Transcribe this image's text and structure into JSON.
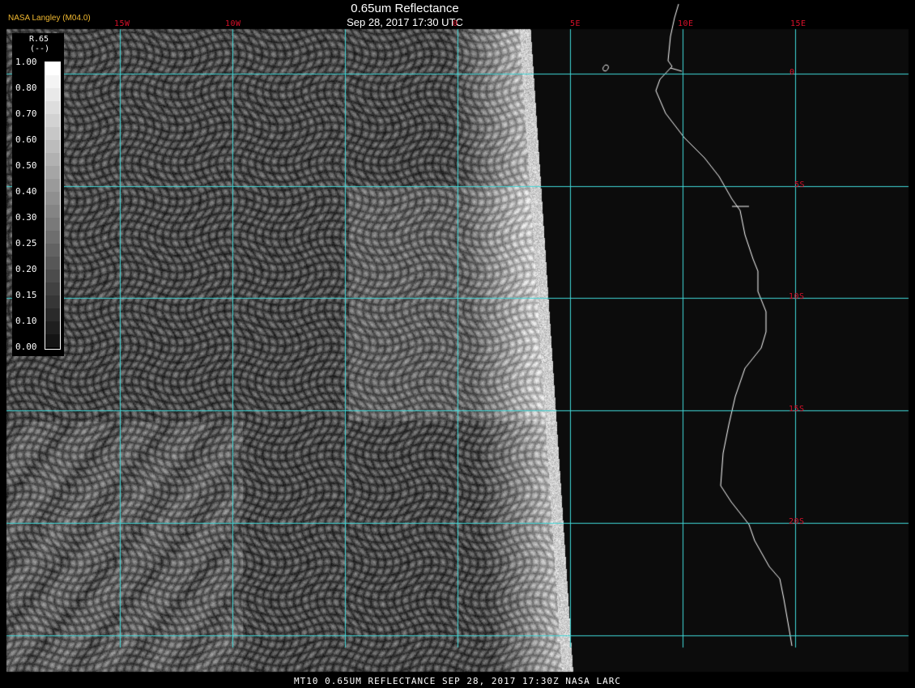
{
  "header": {
    "title": "0.65um Reflectance",
    "subtitle": "Sep 28, 2017 17:30 UTC",
    "organization": "NASA Langley (M04.0)"
  },
  "footer": {
    "text": "MT10  0.65UM REFLECTANCE   SEP 28, 2017 17:30Z   NASA LARC"
  },
  "grid": {
    "line_color": "#40d8d8",
    "label_color": "#d8102a",
    "longitude_labels": [
      "15W",
      "10W",
      "0",
      "5E",
      "10E",
      "15E"
    ],
    "latitude_labels": [
      "0",
      "5S",
      "10S",
      "15S",
      "20S"
    ]
  },
  "colorbar": {
    "parameter": "R.65",
    "unit": "(--)",
    "ticks": [
      "1.00",
      "0.80",
      "0.70",
      "0.60",
      "0.50",
      "0.40",
      "0.30",
      "0.25",
      "0.20",
      "0.15",
      "0.10",
      "0.00"
    ]
  },
  "colors": {
    "background": "#000000",
    "land": "#0c0c0c",
    "coastline": "#ffffff",
    "title_text": "#ffffff",
    "org_text": "#f0b830"
  }
}
